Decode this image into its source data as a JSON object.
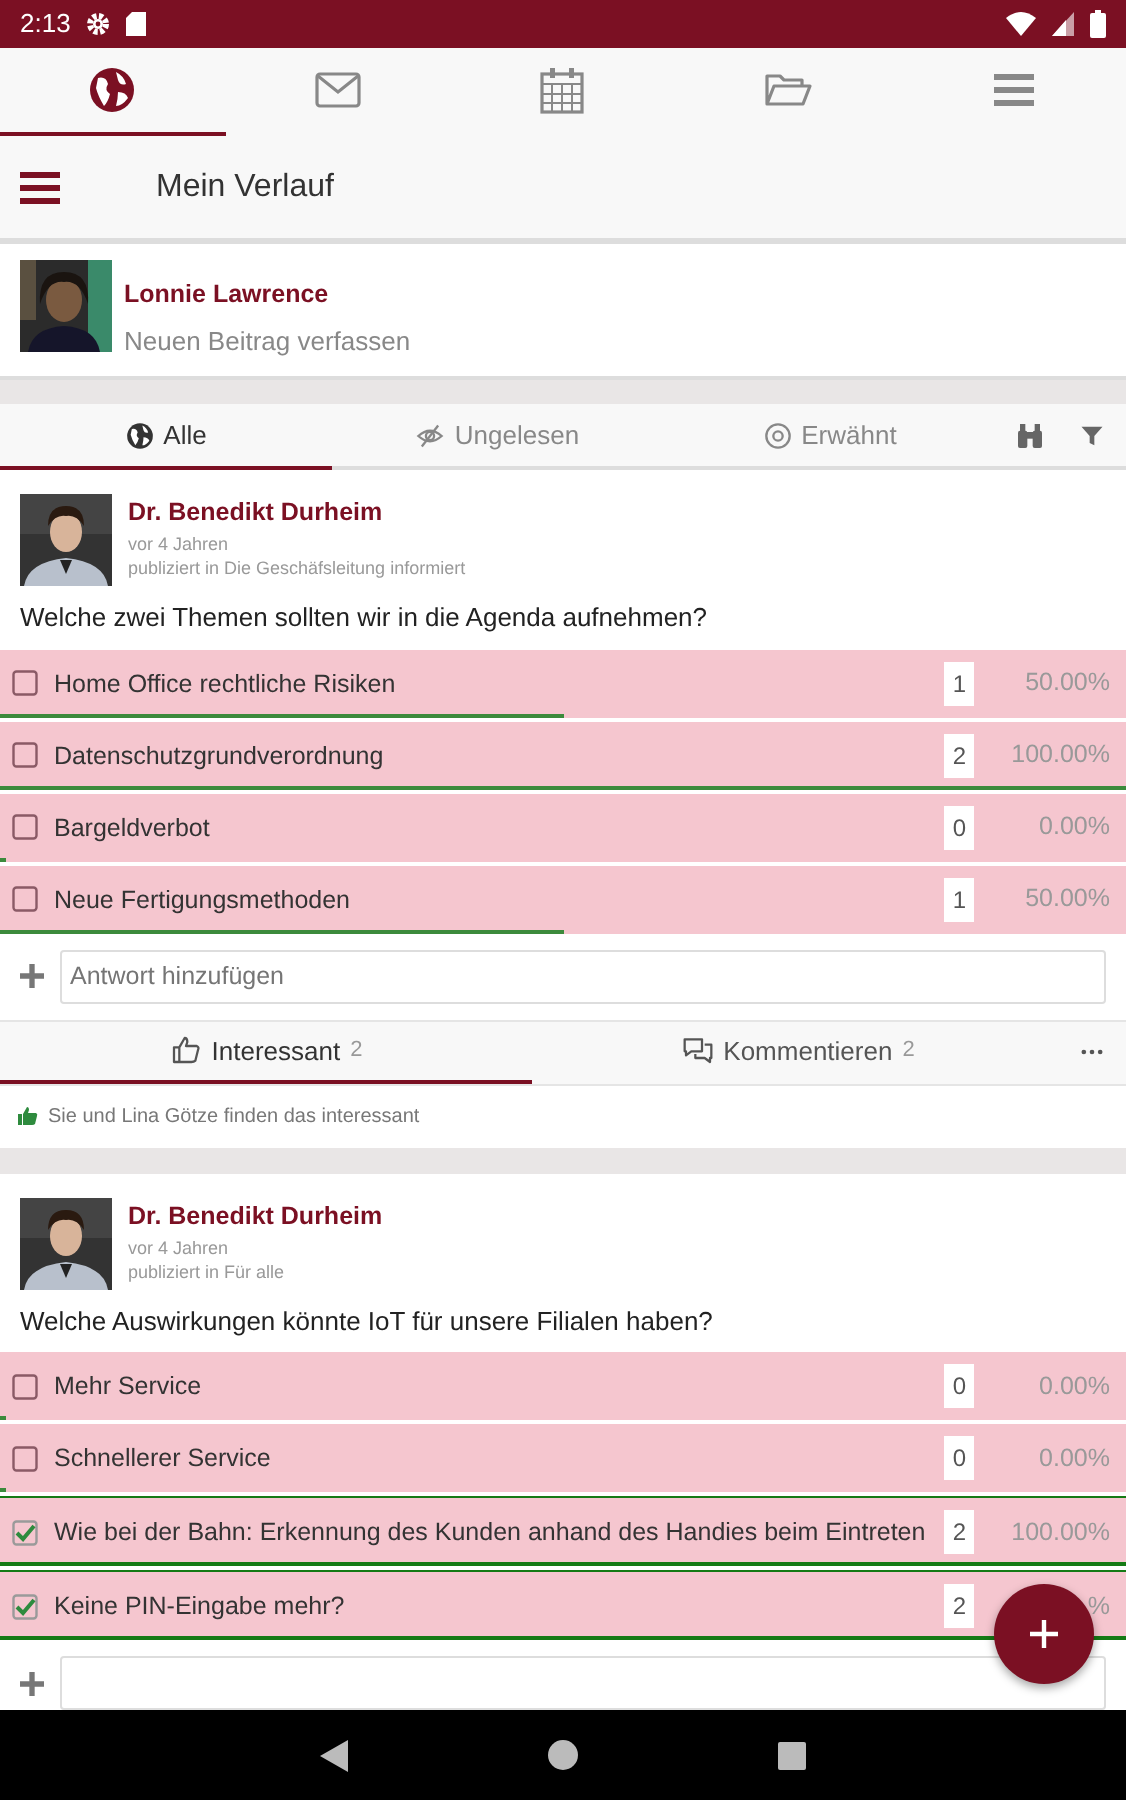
{
  "status_bar": {
    "time": "2:13"
  },
  "top_tabs": [
    {
      "kind": "globe",
      "selected": true
    },
    {
      "kind": "mail",
      "selected": false
    },
    {
      "kind": "calendar",
      "selected": false
    },
    {
      "kind": "folder",
      "selected": false
    },
    {
      "kind": "menu",
      "selected": false
    }
  ],
  "header": {
    "title": "Mein Verlauf"
  },
  "composer": {
    "name": "Lonnie Lawrence",
    "prompt": "Neuen Beitrag verfassen"
  },
  "filter_tabs": [
    {
      "kind": "globe",
      "label": "Alle",
      "selected": true
    },
    {
      "kind": "eye-off",
      "label": "Ungelesen",
      "selected": false
    },
    {
      "kind": "at",
      "label": "Erwähnt",
      "selected": false
    }
  ],
  "posts": [
    {
      "author": "Dr. Benedikt Durheim",
      "time": "vor 4 Jahren",
      "published": "publiziert in Die Geschäfsleitung informiert",
      "question": "Welche zwei Themen sollten wir in die Agenda aufnehmen?",
      "options": [
        {
          "label": "Home Office rechtliche Risiken",
          "checked": false,
          "votes": "1",
          "percent": "50.00%",
          "level": 0.5
        },
        {
          "label": "Datenschutzgrundverordnung",
          "checked": false,
          "votes": "2",
          "percent": "100.00%",
          "level": 1
        },
        {
          "label": "Bargeldverbot",
          "checked": false,
          "votes": "0",
          "percent": "0.00%",
          "level": 0
        },
        {
          "label": "Neue Fertigungsmethoden",
          "checked": false,
          "votes": "1",
          "percent": "50.00%",
          "level": 0.5
        }
      ],
      "answer_placeholder": "Antwort hinzufügen",
      "actions": [
        {
          "kind": "like",
          "label": "Interessant",
          "count": "2",
          "selected": true
        },
        {
          "kind": "comment",
          "label": "Kommentieren",
          "count": "2",
          "selected": false
        }
      ],
      "likes_text": "Sie und Lina Götze finden das interessant"
    },
    {
      "author": "Dr. Benedikt Durheim",
      "time": "vor 4 Jahren",
      "published": "publiziert in Für alle",
      "question": "Welche Auswirkungen könnte IoT für unsere Filialen haben?",
      "options": [
        {
          "label": "Mehr Service",
          "checked": false,
          "votes": "0",
          "percent": "0.00%",
          "level": 0
        },
        {
          "label": "Schnellerer Service",
          "checked": false,
          "votes": "0",
          "percent": "0.00%",
          "level": 0
        },
        {
          "label": "Wie bei der Bahn: Erkennung des Kunden anhand des Handies beim Eintreten",
          "checked": true,
          "votes": "2",
          "percent": "100.00%",
          "level": 1
        },
        {
          "label": "Keine PIN-Eingabe mehr?",
          "checked": true,
          "votes": "2",
          "percent": "%",
          "level": 1
        }
      ]
    }
  ]
}
